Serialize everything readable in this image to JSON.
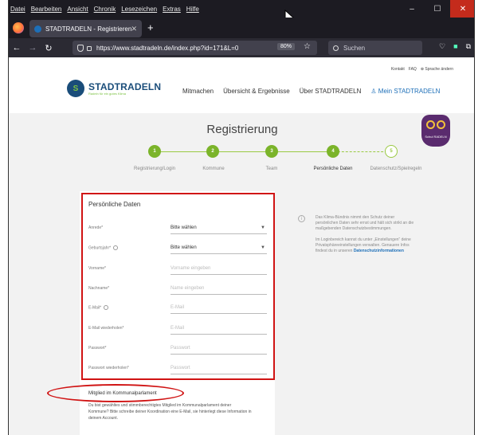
{
  "browser": {
    "menu": [
      "Datei",
      "Bearbeiten",
      "Ansicht",
      "Chronik",
      "Lesezeichen",
      "Extras",
      "Hilfe"
    ],
    "tab_title": "STADTRADELN - Registrieren",
    "url": "https://www.stadtradeln.de/index.php?id=171&L=0",
    "zoom": "80%",
    "search_placeholder": "Suchen"
  },
  "site": {
    "toplinks": [
      "Kontakt",
      "FAQ",
      "Sprache ändern"
    ],
    "logo_name": "STADTRADELN",
    "logo_tagline": "Radeln für ein gutes Klima",
    "nav": [
      "Mitmachen",
      "Übersicht & Ergebnisse",
      "Über STADTRADELN",
      "Mein STADTRADELN"
    ],
    "badge_text": "Schul RADELN"
  },
  "page": {
    "title": "Registrierung",
    "steps": [
      {
        "num": "1",
        "label": "Registrierung/Login"
      },
      {
        "num": "2",
        "label": "Kommune"
      },
      {
        "num": "3",
        "label": "Team"
      },
      {
        "num": "4",
        "label": "Persönliche Daten"
      },
      {
        "num": "5",
        "label": "Datenschutz/Spielregeln"
      }
    ]
  },
  "form": {
    "title": "Persönliche Daten",
    "fields": [
      {
        "label": "Anrede*",
        "value": "Bitte wählen"
      },
      {
        "label": "Geburtsjahr*",
        "value": "Bitte wählen"
      },
      {
        "label": "Vorname*",
        "placeholder": "Vorname eingeben"
      },
      {
        "label": "Nachname*",
        "placeholder": "Name eingeben"
      },
      {
        "label": "E-Mail*",
        "placeholder": "E-Mail"
      },
      {
        "label": "E-Mail wiederholen*",
        "placeholder": "E-Mail"
      },
      {
        "label": "Passwort*",
        "placeholder": "Passwort"
      },
      {
        "label": "Passwort wiederholen*",
        "placeholder": "Passwort"
      }
    ],
    "section2_title": "Mitglied im Kommunalparlament",
    "section2_text": "Du bist gewähltes und stimmberechtigtes Mitglied im Kommunalparlament deiner Kommune? Bitte schreibe deiner Koordination eine E-Mail, sie hinterlegt diese Information in deinem Account."
  },
  "info": {
    "p1": "Das Klima-Bündnis nimmt den Schutz deiner persönlichen Daten sehr ernst und hält sich strikt an die maßgebenden Datenschutzbestimmungen.",
    "p2": "Im Loginbereich kannst du unter „Einstellungen“ deine Privatsphäreeinstellungen verwalten. Genauere Infos findest du in unseren",
    "link": "Datenschutzinformationen"
  }
}
